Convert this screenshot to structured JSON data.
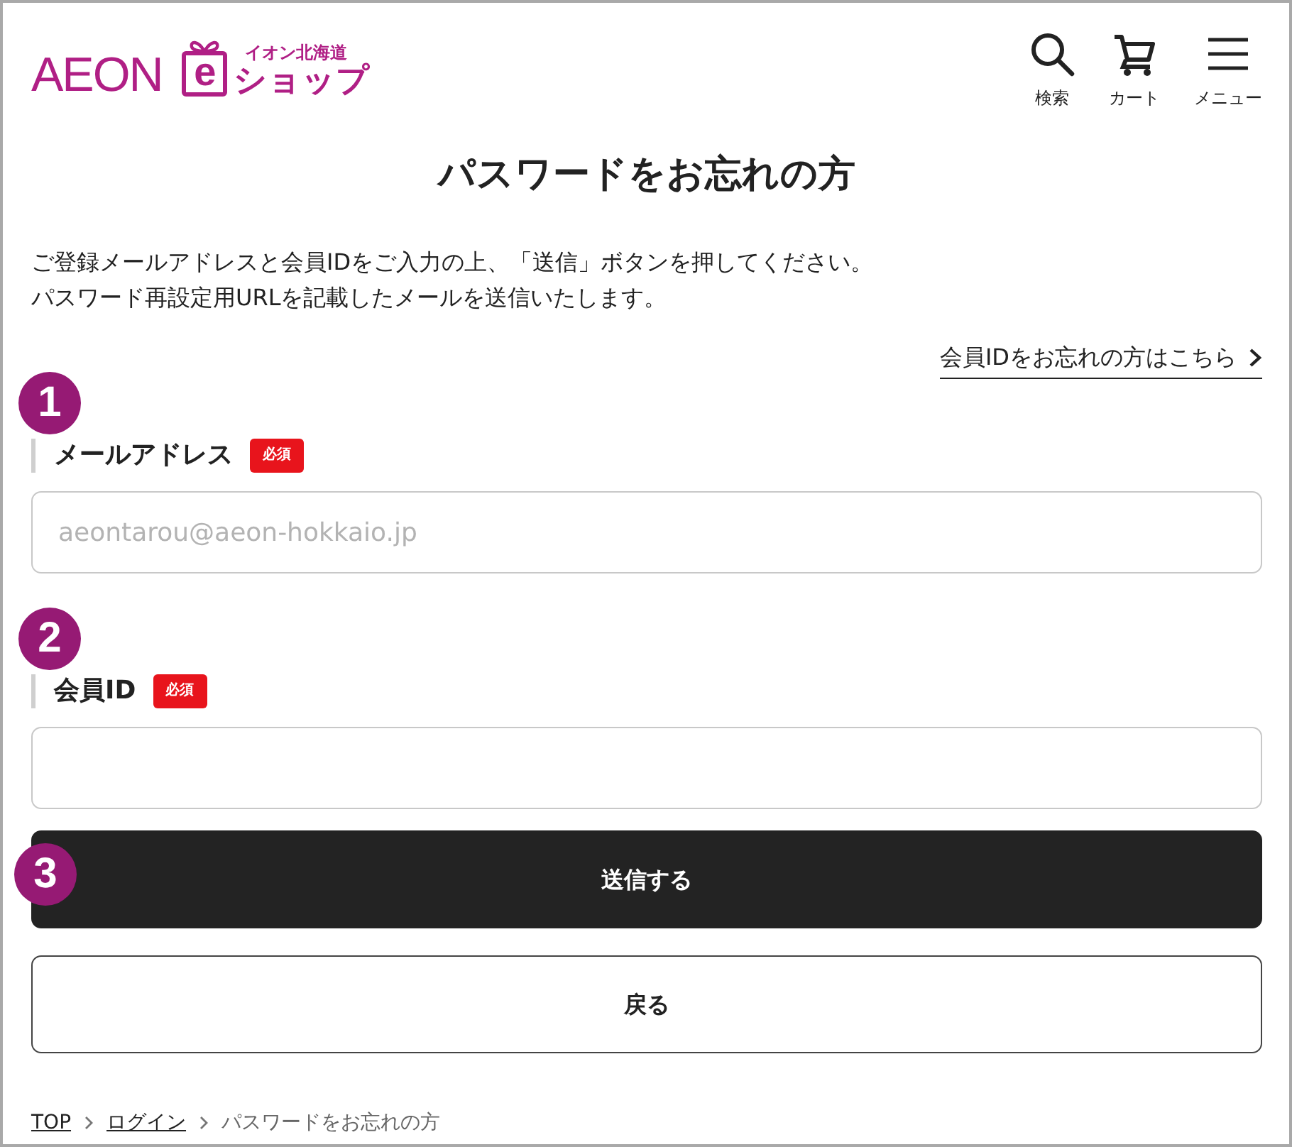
{
  "header": {
    "logo": {
      "wordmark": "AEON",
      "box_letter": "e",
      "region": "イオン北海道",
      "shop": "ショップ"
    },
    "actions": [
      {
        "kind": "search",
        "label": "検索"
      },
      {
        "kind": "cart",
        "label": "カート"
      },
      {
        "kind": "menu",
        "label": "メニュー"
      }
    ]
  },
  "title": "パスワードをお忘れの方",
  "intro": [
    "ご登録メールアドレスと会員IDをご入力の上、「送信」ボタンを押してください。",
    "パスワード再設定用URLを記載したメールを送信いたします。"
  ],
  "forgot_id_link": "会員IDをお忘れの方はこちら",
  "fields": [
    {
      "marker": "1",
      "label": "メールアドレス",
      "required": "必須",
      "placeholder": "aeontarou@aeon-hokkaio.jp"
    },
    {
      "marker": "2",
      "label": "会員ID",
      "required": "必須"
    }
  ],
  "buttons": [
    {
      "kind": "primary",
      "label": "送信する",
      "marker": "3"
    },
    {
      "kind": "secondary",
      "label": "戻る"
    }
  ],
  "breadcrumb": [
    {
      "kind": "link",
      "label": "TOP"
    },
    {
      "kind": "link",
      "label": "ログイン"
    },
    {
      "kind": "current",
      "label": "パスワードをお忘れの方"
    }
  ]
}
